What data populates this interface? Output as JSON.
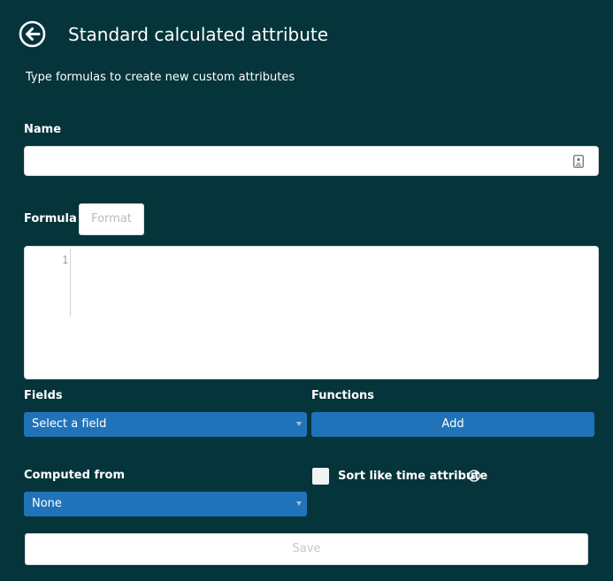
{
  "header": {
    "back_icon": "arrow-left-circle-icon",
    "title": "Standard calculated attribute"
  },
  "subtitle": "Type formulas to create new custom attributes",
  "name_field": {
    "label": "Name",
    "value": "",
    "placeholder": "",
    "icon": "contact-card-icon"
  },
  "formula": {
    "label": "Formula",
    "format_label": "Format",
    "line_numbers": [
      "1"
    ],
    "content": ""
  },
  "fields": {
    "label": "Fields",
    "selected": "Select a field"
  },
  "functions": {
    "label": "Functions",
    "add_label": "Add"
  },
  "computed_from": {
    "label": "Computed from",
    "selected": "None"
  },
  "sort_like_time": {
    "label": "Sort like time attribute",
    "checked": false,
    "info_icon": "info-circle-icon"
  },
  "save_label": "Save",
  "colors": {
    "background": "#05343b",
    "primary": "#2173b9",
    "disabled_text": "#c4c8cc"
  }
}
